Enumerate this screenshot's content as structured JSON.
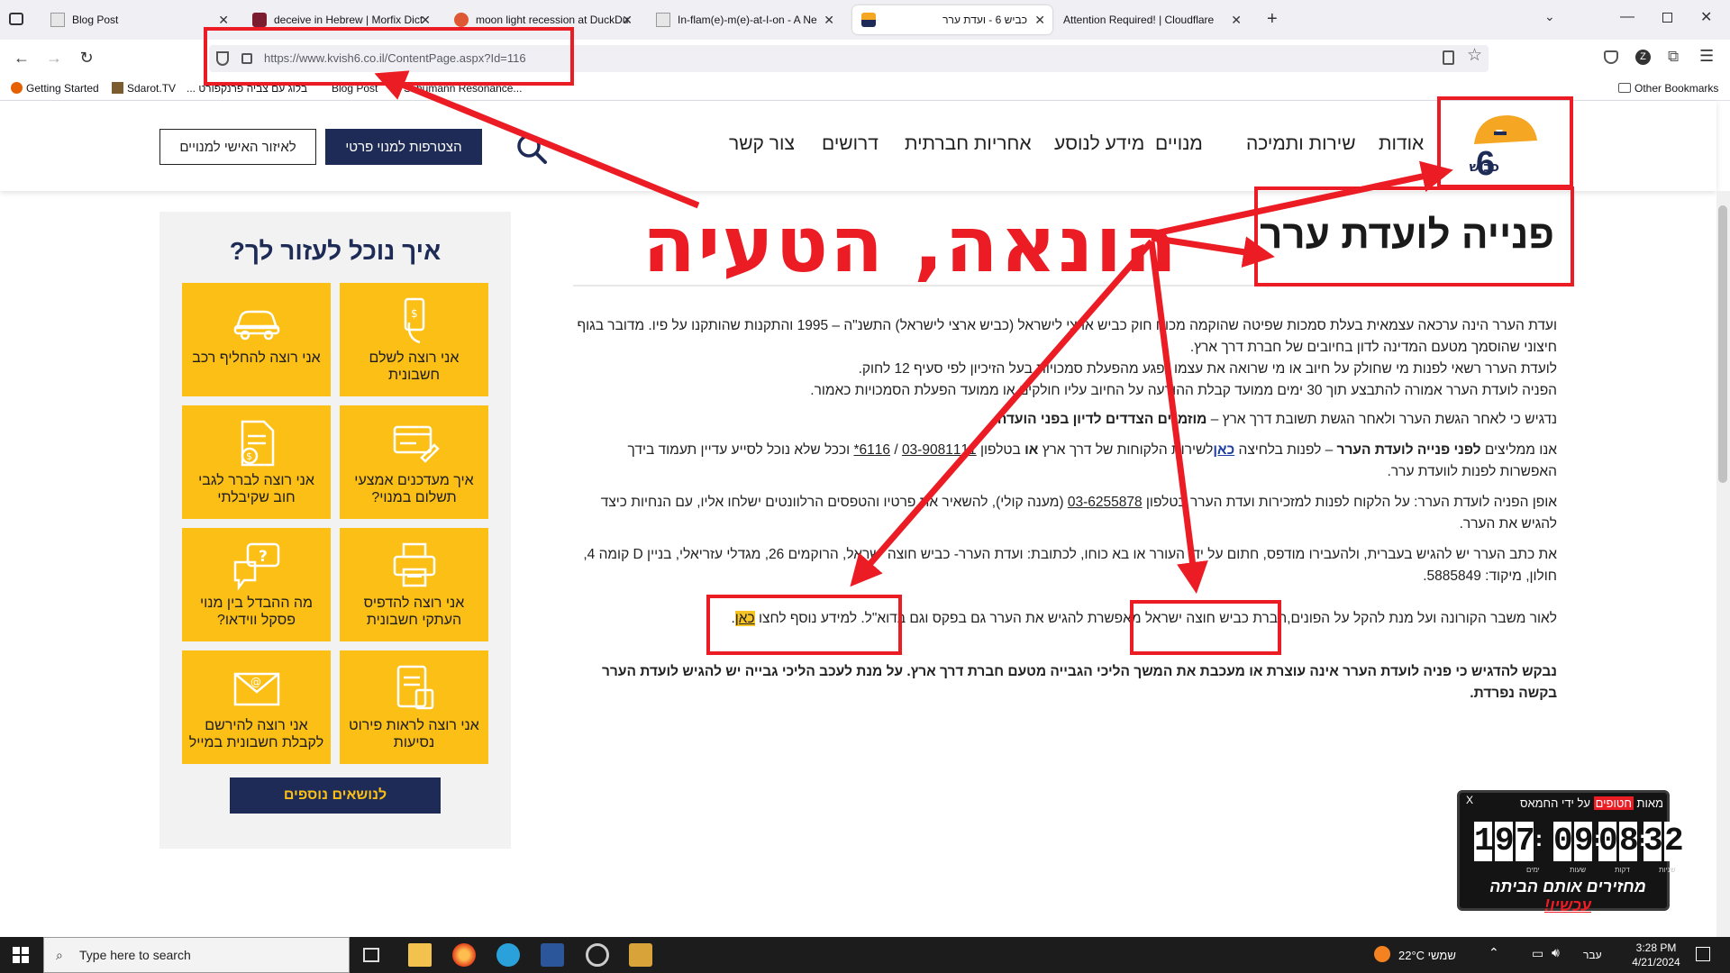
{
  "browser": {
    "tabs": [
      {
        "title": "Blog Post",
        "active": false
      },
      {
        "title": "deceive in Hebrew | Morfix Dict",
        "active": false
      },
      {
        "title": "moon light recession at DuckDu",
        "active": false
      },
      {
        "title": "In-flam(e)-m(e)-at-I-on - A Ne",
        "active": false
      },
      {
        "title": "כביש 6 - ועדת ערר",
        "active": true
      },
      {
        "title": "Attention Required! | Cloudflare",
        "active": false
      }
    ],
    "new_tab": "+",
    "url": "https://www.kvish6.co.il/ContentPage.aspx?Id=116",
    "bookmarks": [
      "Getting Started",
      "Sdarot.TV",
      "בלוג עם צביה פרנקפורט ...",
      "Blog Post",
      "Schumann Resonance..."
    ],
    "other_bookmarks": "Other Bookmarks"
  },
  "site": {
    "logo_text": "כביש 6",
    "nav": [
      "אודות",
      "שירות ותמיכה",
      "מנויים",
      "מידע לנוסע",
      "אחריות חברתית",
      "דרושים",
      "צור קשר"
    ],
    "join_button": "הצטרפות למנוי פרטי",
    "personal_button": "לאיזור האישי למנויים"
  },
  "content": {
    "title": "פנייה לועדת ערר",
    "annotation": "הונאה, הטעיה",
    "p1": "ועדת הערר הינה ערכאה עצמאית בעלת סמכות שפיטה שהוקמה מכוח חוק כביש ארצי לישראל (כביש ארצי לישראל) התשנ\"ה – 1995 והתקנות שהותקנו על פיו. מדובר בגוף חיצוני שהוסמך מטעם המדינה לדון בחיובים של חברת דרך ארץ.",
    "p1b": "לועדת הערר רשאי לפנות מי שחולק על חיוב או מי שרואה את עצמו נפגע מהפעלת סמכויות בעל הזיכיון לפי סעיף 12 לחוק.",
    "p1c": "הפניה לועדת הערר אמורה להתבצע תוך 30 ימים ממועד קבלת ההודעה על החיוב עליו חולקים או ממועד הפעלת הסמכויות כאמור.",
    "p2a": "נדגיש כי לאחר הגשת הערר ולאחר הגשת תשובת דרך ארץ –",
    "p2b": "מוזמנים הצדדים לדיון בפני הועדה.",
    "p3a": "אנו ממליצים",
    "p3b": "לפני פנייה לועדת הערר",
    "p3c": "– לפנות בלחיצה",
    "p3link": "כאן",
    "p3d": "לשירות הלקוחות של דרך ארץ",
    "p3e": "או",
    "p3f": "בטלפון",
    "p3phone1": "03-9081111",
    "p3phone2": "6116*",
    "p3g": "וככל שלא נוכל לסייע עדיין תעמוד בידך האפשרות לפנות לוועדת ערר.",
    "p4a": "אופן הפניה לועדת הערר: על הלקוח לפנות למזכירות ועדת הערר בטלפון",
    "p4phone": "03-6255878",
    "p4b": "(מענה קולי), להשאיר את פרטיו והטפסים הרלוונטים ישלחו אליו, עם הנחיות כיצד להגיש את הערר.",
    "p5": "את כתב הערר יש להגיש בעברית, ולהעבירו מודפס, חתום על ידי העורר או בא כוחו, לכתובת: ועדת הערר- כביש חוצה ישראל, הרוקמים 26, מגדלי עזריאלי, בניין D קומה 4, חולון, מיקוד: 5885849.",
    "p6a": "לאור משבר הקורונה ועל מנת להקל על הפונים,",
    "p6b": "חברת כביש חוצה ישראל",
    "p6c": "מאפשרת להגיש את הערר גם בפקס וגם בדוא\"ל. למידע נוסף לחצו",
    "p6link": "כאן",
    "p7": "נבקש להדגיש כי פניה לועדת הערר אינה עוצרת או מעכבת את המשך הליכי הגבייה מטעם חברת דרך ארץ. על מנת לעכב הליכי גבייה יש להגיש לועדת הערר בקשה נפרדת."
  },
  "sidebar": {
    "title": "איך נוכל לעזור לך?",
    "tiles": [
      {
        "label": "אני רוצה לשלם חשבונית",
        "icon": "phone-payment-icon"
      },
      {
        "label": "אני רוצה להחליף רכב",
        "icon": "car-icon"
      },
      {
        "label": "איך מעדכנים אמצעי תשלום במנוי?",
        "icon": "card-edit-icon"
      },
      {
        "label": "אני רוצה לברר לגבי חוב שקיבלתי",
        "icon": "document-dollar-icon"
      },
      {
        "label": "אני רוצה להדפיס העתקי חשבונית",
        "icon": "printer-icon"
      },
      {
        "label": "מה ההבדל בין מנוי פסקל ווידאו?",
        "icon": "chat-question-icon"
      },
      {
        "label": "אני רוצה לראות פירוט נסיעות",
        "icon": "document-list-icon"
      },
      {
        "label": "אני רוצה להירשם לקבלת חשבונית במייל",
        "icon": "envelope-icon"
      }
    ],
    "more_button": "לנושאים נוספים"
  },
  "widget": {
    "header_prefix": "מאות",
    "header_red": "חטופים",
    "header_suffix": "על ידי החמאס",
    "close": "X",
    "days": "197",
    "hours": "09",
    "minutes": "08",
    "seconds": "32",
    "unit_days": "ימים",
    "unit_hours": "שעות",
    "unit_minutes": "דקות",
    "unit_seconds": "שניות",
    "footer_a": "מחזירים אותם הביתה",
    "footer_b": "עכשיו!"
  },
  "taskbar": {
    "search_placeholder": "Type here to search",
    "weather": "22°C שמשי",
    "lang": "עבר",
    "time": "3:28 PM",
    "date": "4/21/2024"
  },
  "colors": {
    "accent_yellow": "#fbbf15",
    "navy": "#1d2b56",
    "annotation_red": "#ec1c24"
  }
}
